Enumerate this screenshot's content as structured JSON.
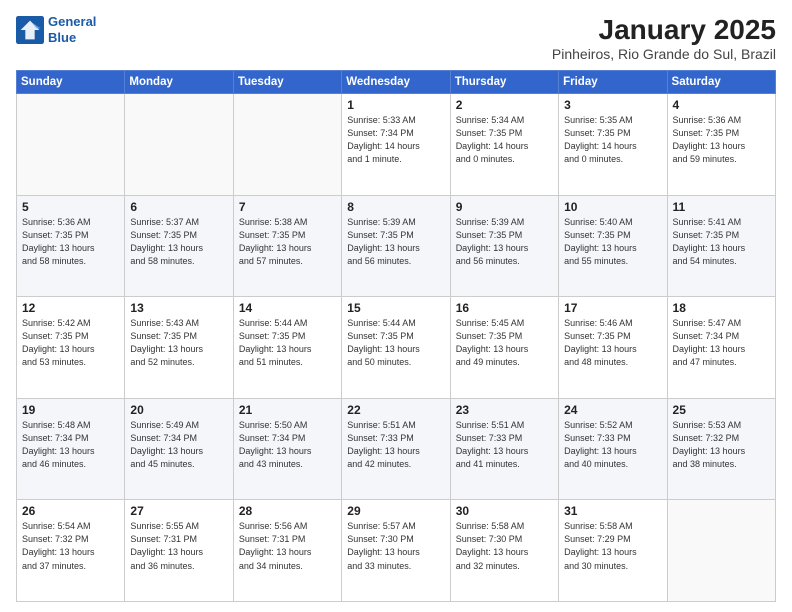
{
  "logo": {
    "line1": "General",
    "line2": "Blue"
  },
  "title": "January 2025",
  "subtitle": "Pinheiros, Rio Grande do Sul, Brazil",
  "days_of_week": [
    "Sunday",
    "Monday",
    "Tuesday",
    "Wednesday",
    "Thursday",
    "Friday",
    "Saturday"
  ],
  "weeks": [
    [
      {
        "day": "",
        "info": ""
      },
      {
        "day": "",
        "info": ""
      },
      {
        "day": "",
        "info": ""
      },
      {
        "day": "1",
        "info": "Sunrise: 5:33 AM\nSunset: 7:34 PM\nDaylight: 14 hours\nand 1 minute."
      },
      {
        "day": "2",
        "info": "Sunrise: 5:34 AM\nSunset: 7:35 PM\nDaylight: 14 hours\nand 0 minutes."
      },
      {
        "day": "3",
        "info": "Sunrise: 5:35 AM\nSunset: 7:35 PM\nDaylight: 14 hours\nand 0 minutes."
      },
      {
        "day": "4",
        "info": "Sunrise: 5:36 AM\nSunset: 7:35 PM\nDaylight: 13 hours\nand 59 minutes."
      }
    ],
    [
      {
        "day": "5",
        "info": "Sunrise: 5:36 AM\nSunset: 7:35 PM\nDaylight: 13 hours\nand 58 minutes."
      },
      {
        "day": "6",
        "info": "Sunrise: 5:37 AM\nSunset: 7:35 PM\nDaylight: 13 hours\nand 58 minutes."
      },
      {
        "day": "7",
        "info": "Sunrise: 5:38 AM\nSunset: 7:35 PM\nDaylight: 13 hours\nand 57 minutes."
      },
      {
        "day": "8",
        "info": "Sunrise: 5:39 AM\nSunset: 7:35 PM\nDaylight: 13 hours\nand 56 minutes."
      },
      {
        "day": "9",
        "info": "Sunrise: 5:39 AM\nSunset: 7:35 PM\nDaylight: 13 hours\nand 56 minutes."
      },
      {
        "day": "10",
        "info": "Sunrise: 5:40 AM\nSunset: 7:35 PM\nDaylight: 13 hours\nand 55 minutes."
      },
      {
        "day": "11",
        "info": "Sunrise: 5:41 AM\nSunset: 7:35 PM\nDaylight: 13 hours\nand 54 minutes."
      }
    ],
    [
      {
        "day": "12",
        "info": "Sunrise: 5:42 AM\nSunset: 7:35 PM\nDaylight: 13 hours\nand 53 minutes."
      },
      {
        "day": "13",
        "info": "Sunrise: 5:43 AM\nSunset: 7:35 PM\nDaylight: 13 hours\nand 52 minutes."
      },
      {
        "day": "14",
        "info": "Sunrise: 5:44 AM\nSunset: 7:35 PM\nDaylight: 13 hours\nand 51 minutes."
      },
      {
        "day": "15",
        "info": "Sunrise: 5:44 AM\nSunset: 7:35 PM\nDaylight: 13 hours\nand 50 minutes."
      },
      {
        "day": "16",
        "info": "Sunrise: 5:45 AM\nSunset: 7:35 PM\nDaylight: 13 hours\nand 49 minutes."
      },
      {
        "day": "17",
        "info": "Sunrise: 5:46 AM\nSunset: 7:35 PM\nDaylight: 13 hours\nand 48 minutes."
      },
      {
        "day": "18",
        "info": "Sunrise: 5:47 AM\nSunset: 7:34 PM\nDaylight: 13 hours\nand 47 minutes."
      }
    ],
    [
      {
        "day": "19",
        "info": "Sunrise: 5:48 AM\nSunset: 7:34 PM\nDaylight: 13 hours\nand 46 minutes."
      },
      {
        "day": "20",
        "info": "Sunrise: 5:49 AM\nSunset: 7:34 PM\nDaylight: 13 hours\nand 45 minutes."
      },
      {
        "day": "21",
        "info": "Sunrise: 5:50 AM\nSunset: 7:34 PM\nDaylight: 13 hours\nand 43 minutes."
      },
      {
        "day": "22",
        "info": "Sunrise: 5:51 AM\nSunset: 7:33 PM\nDaylight: 13 hours\nand 42 minutes."
      },
      {
        "day": "23",
        "info": "Sunrise: 5:51 AM\nSunset: 7:33 PM\nDaylight: 13 hours\nand 41 minutes."
      },
      {
        "day": "24",
        "info": "Sunrise: 5:52 AM\nSunset: 7:33 PM\nDaylight: 13 hours\nand 40 minutes."
      },
      {
        "day": "25",
        "info": "Sunrise: 5:53 AM\nSunset: 7:32 PM\nDaylight: 13 hours\nand 38 minutes."
      }
    ],
    [
      {
        "day": "26",
        "info": "Sunrise: 5:54 AM\nSunset: 7:32 PM\nDaylight: 13 hours\nand 37 minutes."
      },
      {
        "day": "27",
        "info": "Sunrise: 5:55 AM\nSunset: 7:31 PM\nDaylight: 13 hours\nand 36 minutes."
      },
      {
        "day": "28",
        "info": "Sunrise: 5:56 AM\nSunset: 7:31 PM\nDaylight: 13 hours\nand 34 minutes."
      },
      {
        "day": "29",
        "info": "Sunrise: 5:57 AM\nSunset: 7:30 PM\nDaylight: 13 hours\nand 33 minutes."
      },
      {
        "day": "30",
        "info": "Sunrise: 5:58 AM\nSunset: 7:30 PM\nDaylight: 13 hours\nand 32 minutes."
      },
      {
        "day": "31",
        "info": "Sunrise: 5:58 AM\nSunset: 7:29 PM\nDaylight: 13 hours\nand 30 minutes."
      },
      {
        "day": "",
        "info": ""
      }
    ]
  ]
}
